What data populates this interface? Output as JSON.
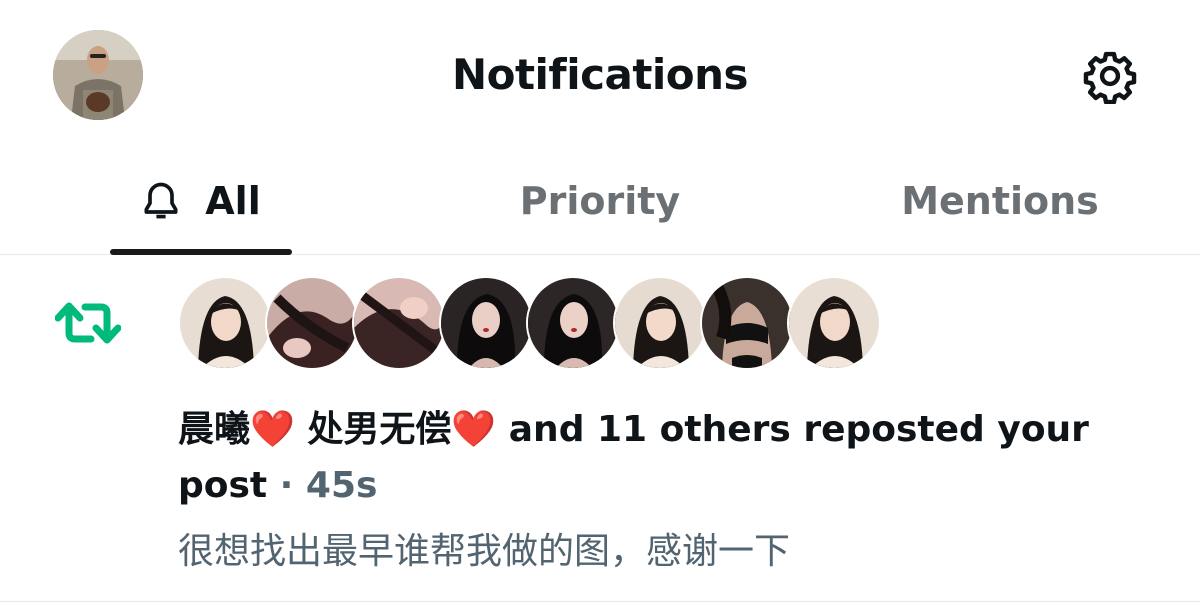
{
  "header": {
    "title": "Notifications",
    "avatar_icon": "user-avatar",
    "settings_icon": "gear-icon"
  },
  "tabs": [
    {
      "label": "All",
      "icon": "bell-icon",
      "active": true
    },
    {
      "label": "Priority",
      "active": false
    },
    {
      "label": "Mentions",
      "active": false
    }
  ],
  "notification": {
    "icon": "repost-icon",
    "icon_color": "#00ba7c",
    "avatar_count": 8,
    "name1": "晨曦",
    "heart1": "❤️",
    "name2": "处男无偿",
    "heart2": "❤️",
    "action": " and 11 others reposted your post",
    "separator": " · ",
    "time": "45s",
    "post_text": "很想找出最早谁帮我做的图，感谢一下"
  },
  "colors": {
    "text_primary": "#0f1419",
    "text_secondary": "#536471",
    "repost_green": "#00ba7c",
    "divider": "#e6e9ec"
  }
}
